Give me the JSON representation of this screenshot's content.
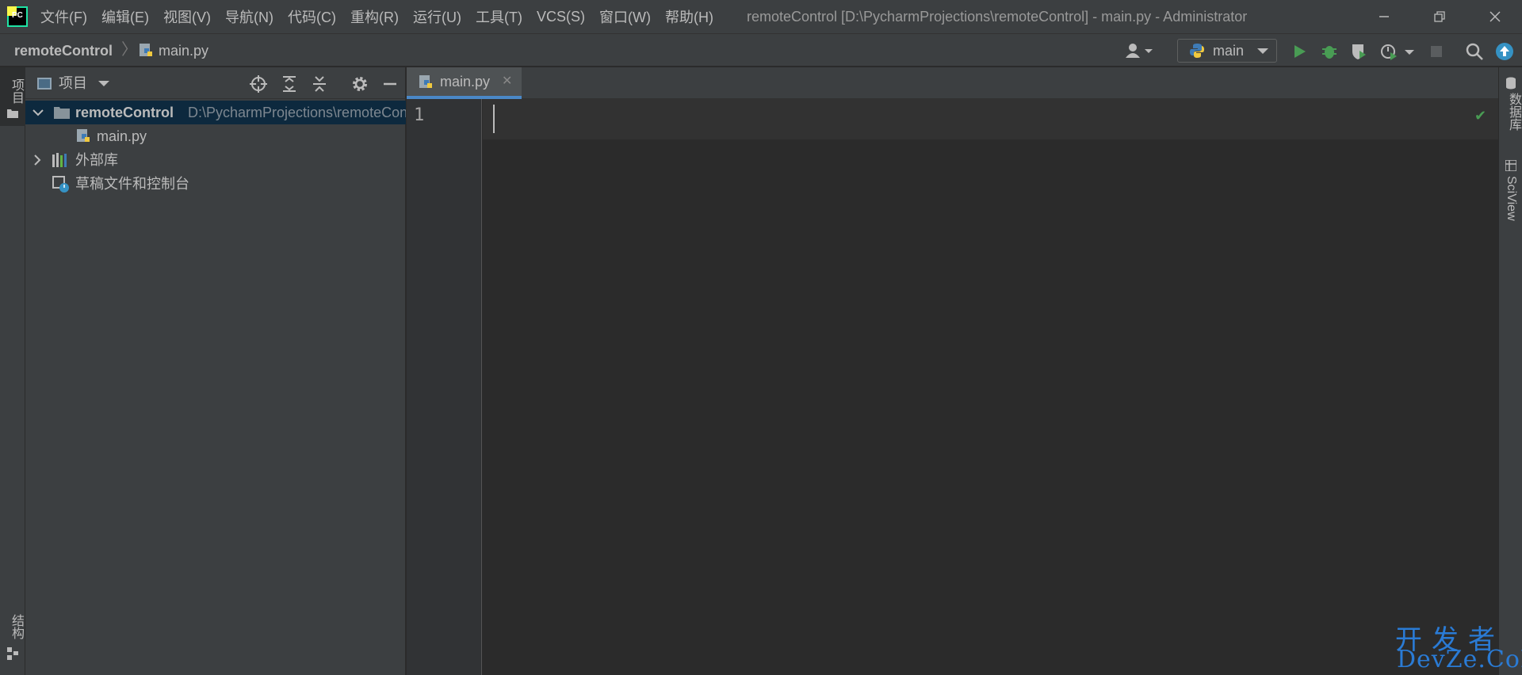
{
  "app": {
    "logo_text": "PC",
    "window_title": "remoteControl [D:\\PycharmProjections\\remoteControl] - main.py - Administrator"
  },
  "menu": [
    "文件(F)",
    "编辑(E)",
    "视图(V)",
    "导航(N)",
    "代码(C)",
    "重构(R)",
    "运行(U)",
    "工具(T)",
    "VCS(S)",
    "窗口(W)",
    "帮助(H)"
  ],
  "window_controls": {
    "minimize": "—",
    "restore": "❐",
    "close": "✕"
  },
  "navbar": {
    "project": "remoteControl",
    "file": "main.py",
    "run_config": "main"
  },
  "left_strip": {
    "project_tab": "项目",
    "structure_tab": "结构"
  },
  "project_panel": {
    "title": "项目",
    "tree": [
      {
        "label": "remoteControl",
        "path": "D:\\PycharmProjections\\remoteControl",
        "expanded": true,
        "selected": true
      },
      {
        "label": "main.py"
      },
      {
        "label": "外部库",
        "expanded": false
      },
      {
        "label": "草稿文件和控制台"
      }
    ]
  },
  "editor": {
    "tab_label": "main.py",
    "tab_close": "✕",
    "line_number": "1"
  },
  "right_strip": {
    "database_tab": "数据库",
    "sciview_tab": "SciView"
  },
  "watermark": {
    "top": "开发者",
    "bottom": "DevZe.CoM"
  },
  "colors": {
    "background": "#2b2b2b",
    "panel": "#3c3f41",
    "accent": "#4a88c7",
    "run_green": "#499c54"
  }
}
